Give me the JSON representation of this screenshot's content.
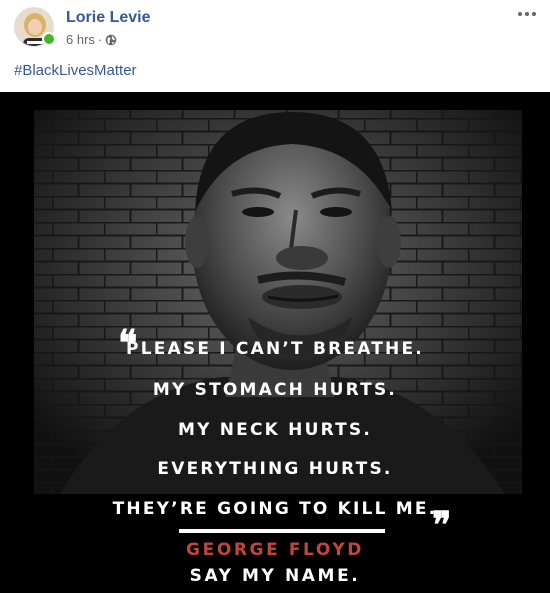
{
  "post": {
    "author": "Lorie Levie",
    "timestamp": "6 hrs",
    "separator": "·",
    "audience_icon": "globe-icon",
    "more_icon": "more-options-icon",
    "text": "#BlackLivesMatter",
    "online": true
  },
  "image": {
    "quote_lines": [
      "PLEASE I CAN’T BREATHE.",
      "MY STOMACH HURTS.",
      "MY NECK HURTS.",
      "EVERYTHING HURTS.",
      "THEY’RE GOING TO KILL ME."
    ],
    "attribution": "GEORGE FLOYD",
    "tagline": "SAY MY NAME.",
    "open_quote": "❝",
    "close_quote": "❞"
  },
  "colors": {
    "link_blue": "#385898",
    "online_green": "#42b72a",
    "attribution_red": "#c0453d"
  }
}
